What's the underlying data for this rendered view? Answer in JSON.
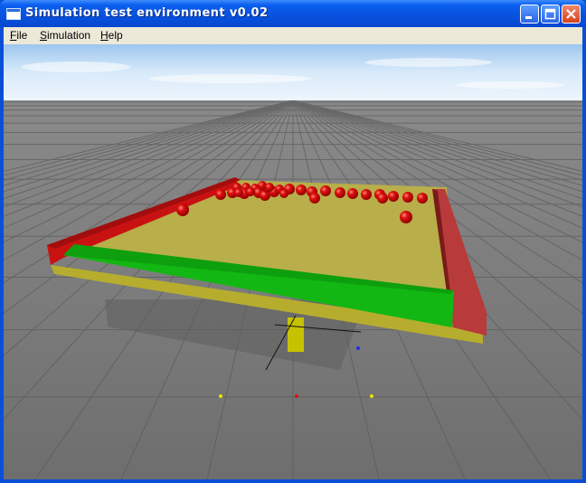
{
  "window": {
    "title": "Simulation test environment v0.02",
    "icon": "app-window-icon",
    "controls": [
      "minimize-icon",
      "maximize-icon",
      "close-icon"
    ]
  },
  "menu": [
    {
      "label": "File",
      "accel": "F",
      "rest": "ile"
    },
    {
      "label": "Simulation",
      "accel": "S",
      "rest": "imulation"
    },
    {
      "label": "Help",
      "accel": "H",
      "rest": "elp"
    }
  ],
  "scene": {
    "sky_color": "#bcd9f2",
    "floor_color": "#7f7f7f",
    "board_color": "#b8ae4a",
    "wall_red": "#c41414",
    "wall_green": "#10b010",
    "ball_color": "#e01010",
    "ball_count": 31
  }
}
